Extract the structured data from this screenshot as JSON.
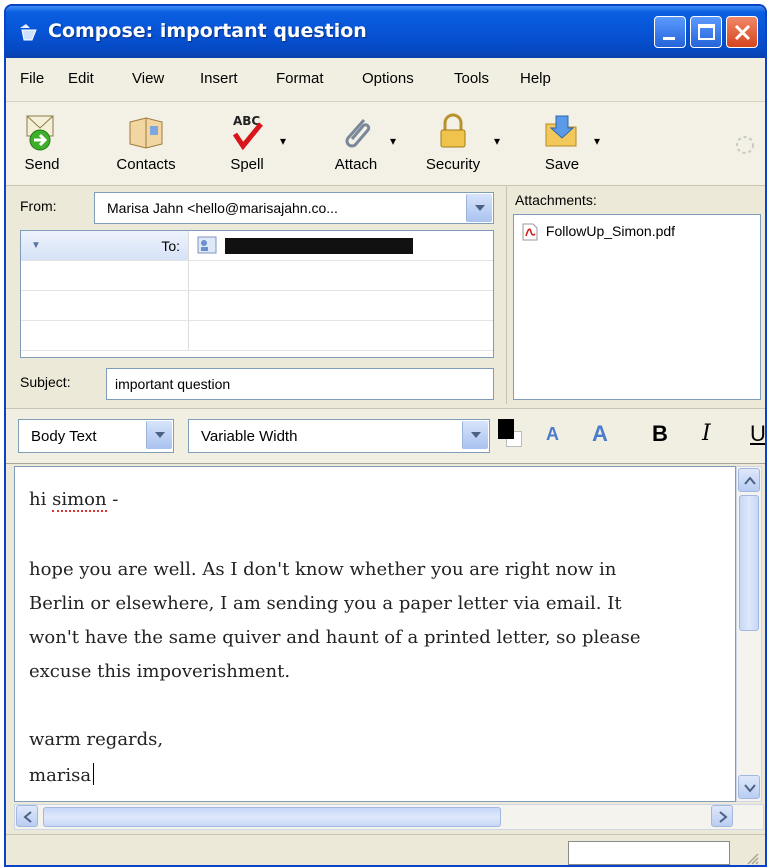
{
  "window": {
    "title": "Compose: important question",
    "icon": "compose-icon",
    "controls": [
      "minimize-icon",
      "maximize-icon",
      "close-icon"
    ],
    "colors": {
      "titlebar": "#0754d6",
      "close": "#d4441c",
      "chrome": "#ece9d8"
    }
  },
  "menu": {
    "items": [
      {
        "label": "File"
      },
      {
        "label": "Edit"
      },
      {
        "label": "View"
      },
      {
        "label": "Insert"
      },
      {
        "label": "Format"
      },
      {
        "label": "Options"
      },
      {
        "label": "Tools"
      },
      {
        "label": "Help"
      }
    ]
  },
  "toolbar": {
    "send": "Send",
    "contacts": "Contacts",
    "spell": "Spell",
    "spell_icon_text": "ABC",
    "attach": "Attach",
    "security": "Security",
    "save": "Save"
  },
  "header": {
    "from_label": "From:",
    "from_value": "Marisa Jahn <hello@marisajahn.co...",
    "to_label": "To:",
    "subject_label": "Subject:",
    "subject_value": "important question"
  },
  "attachments": {
    "label": "Attachments:",
    "items": [
      {
        "name": "FollowUp_Simon.pdf",
        "icon": "pdf-icon"
      }
    ]
  },
  "format": {
    "paragraph_style": "Body Text",
    "font": "Variable Width",
    "smaller": "A",
    "larger": "A",
    "bold": "B",
    "italic": "I",
    "underline": "U",
    "text_color": "#000000"
  },
  "body": {
    "greeting_prefix": "hi ",
    "greeting_name": "simon",
    "greeting_suffix": " -",
    "line1": "hope you are well.  As I don't know whether you are right now in",
    "line2": "Berlin or elsewhere, I am sending you a paper letter via email.  It",
    "line3": "won't have the same quiver and haunt of a printed letter, so please",
    "line4": "excuse this impoverishment.",
    "closing": "warm regards,",
    "signature": "marisa"
  }
}
